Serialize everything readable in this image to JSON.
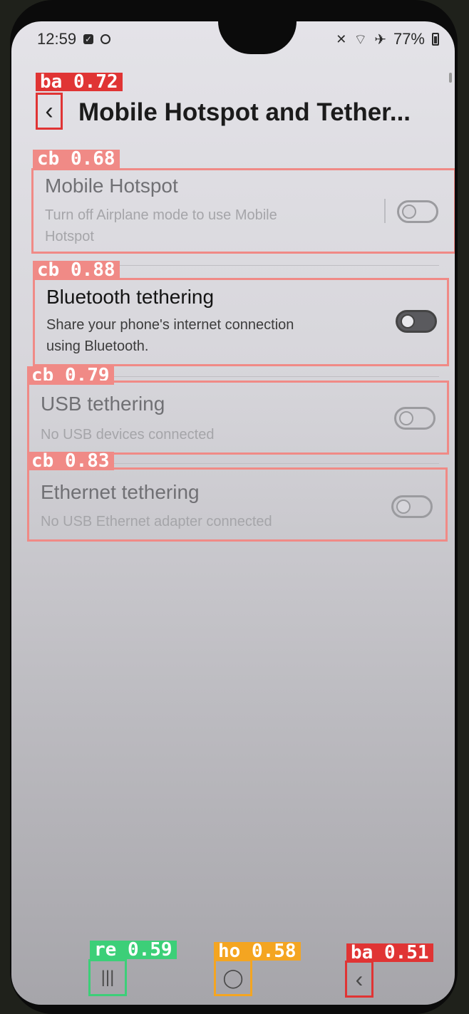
{
  "status_bar": {
    "time": "12:59",
    "battery": "77%",
    "airplane_icon": "✈",
    "wifi_icon": "⌔",
    "mute_icon": "✕"
  },
  "header": {
    "back_icon": "‹",
    "title": "Mobile Hotspot and Tether..."
  },
  "rows": [
    {
      "title": "Mobile Hotspot",
      "subtitle_1": "Turn off Airplane mode to use Mobile",
      "subtitle_2": "Hotspot"
    },
    {
      "title": "Bluetooth tethering",
      "subtitle_1": "Share your phone's internet connection",
      "subtitle_2": "using Bluetooth."
    },
    {
      "title": "USB tethering",
      "subtitle_1": "No USB devices connected"
    },
    {
      "title": "Ethernet tethering",
      "subtitle_1": "No USB Ethernet adapter connected"
    }
  ],
  "detections": {
    "back_top": "ba 0.72",
    "row_hotspot": "cb 0.68",
    "row_bluetooth": "cb 0.88",
    "row_usb": "cb 0.79",
    "row_ethernet": "cb 0.83",
    "nav_recents": "re 0.59",
    "nav_home": "ho 0.58",
    "nav_back": "ba 0.51"
  },
  "nav_bar": {
    "recents_icon": "|||",
    "home_icon": "◯",
    "back_icon": "‹"
  },
  "colors": {
    "red": "#e03434",
    "salmon": "#f08a86",
    "green": "#3ccf78",
    "orange": "#f4a521"
  }
}
